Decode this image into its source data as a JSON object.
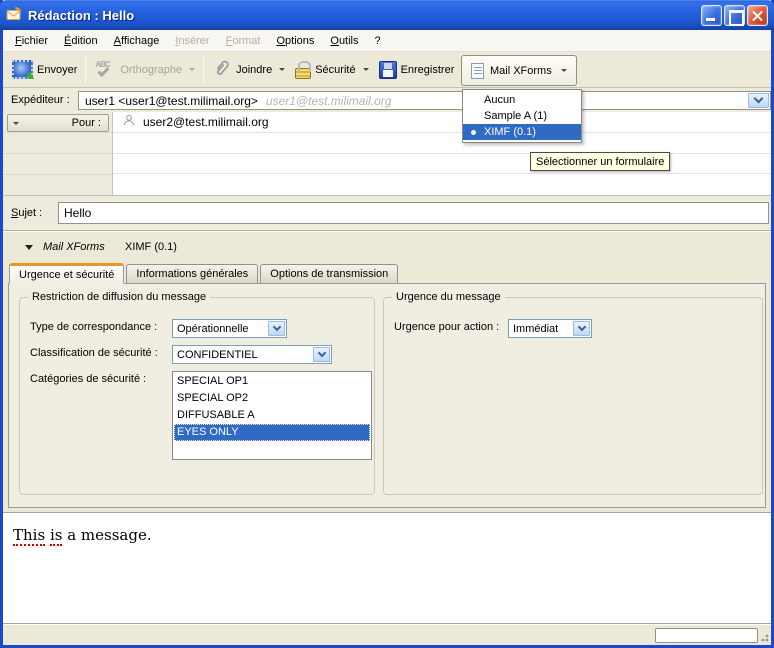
{
  "window": {
    "title": "Rédaction : Hello"
  },
  "menubar": {
    "items": [
      {
        "label": "Fichier",
        "enabled": true
      },
      {
        "label": "Édition",
        "enabled": true
      },
      {
        "label": "Affichage",
        "enabled": true
      },
      {
        "label": "Insérer",
        "enabled": false
      },
      {
        "label": "Format",
        "enabled": false
      },
      {
        "label": "Options",
        "enabled": true
      },
      {
        "label": "Outils",
        "enabled": true
      },
      {
        "label": "?",
        "enabled": true
      }
    ]
  },
  "toolbar": {
    "buttons": [
      {
        "label": "Envoyer",
        "enabled": true
      },
      {
        "label": "Orthographe",
        "enabled": false
      },
      {
        "label": "Joindre",
        "enabled": true
      },
      {
        "label": "Sécurité",
        "enabled": true
      },
      {
        "label": "Enregistrer",
        "enabled": true
      },
      {
        "label": "Mail XForms",
        "enabled": true
      }
    ]
  },
  "compose": {
    "from_label": "Expéditeur :",
    "from_value": "user1 <user1@test.milimail.org>",
    "from_hint": "user1@test.milimail.org",
    "to_label": "Pour :",
    "to_value": "user2@test.milimail.org",
    "subject_label": "Sujet :",
    "subject_value": "Hello"
  },
  "forms_menu": {
    "items": [
      "Aucun",
      "Sample A (1)",
      "XIMF (0.1)"
    ],
    "selected": "XIMF (0.1)"
  },
  "tooltip": {
    "text": "Sélectionner un formulaire"
  },
  "xforms": {
    "section_label": "Mail XForms",
    "form_name": "XIMF (0.1)",
    "tabs": [
      "Urgence et sécurité",
      "Informations générales",
      "Options de transmission"
    ],
    "active_tab": "Urgence et sécurité",
    "restriction": {
      "legend": "Restriction de diffusion du message",
      "type_label": "Type de correspondance :",
      "type_value": "Opérationnelle",
      "classification_label": "Classification de sécurité :",
      "classification_value": "CONFIDENTIEL",
      "categories_label": "Catégories de sécurité :",
      "categories": [
        "SPECIAL OP1",
        "SPECIAL OP2",
        "DIFFUSABLE A",
        "EYES ONLY"
      ],
      "selected_category": "EYES ONLY"
    },
    "urgency": {
      "legend": "Urgence du message",
      "action_label": "Urgence pour action :",
      "action_value": "Immédiat"
    }
  },
  "body": {
    "part1": "This",
    "part2": "is",
    "part3": " a message."
  },
  "colors": {
    "selection": "#316ac5",
    "titlebar": "#2561dd",
    "chrome": "#ece9d8",
    "tab_accent": "#ec9524",
    "tooltip_bg": "#ffffe1",
    "spellcheck": "#cc0000"
  }
}
